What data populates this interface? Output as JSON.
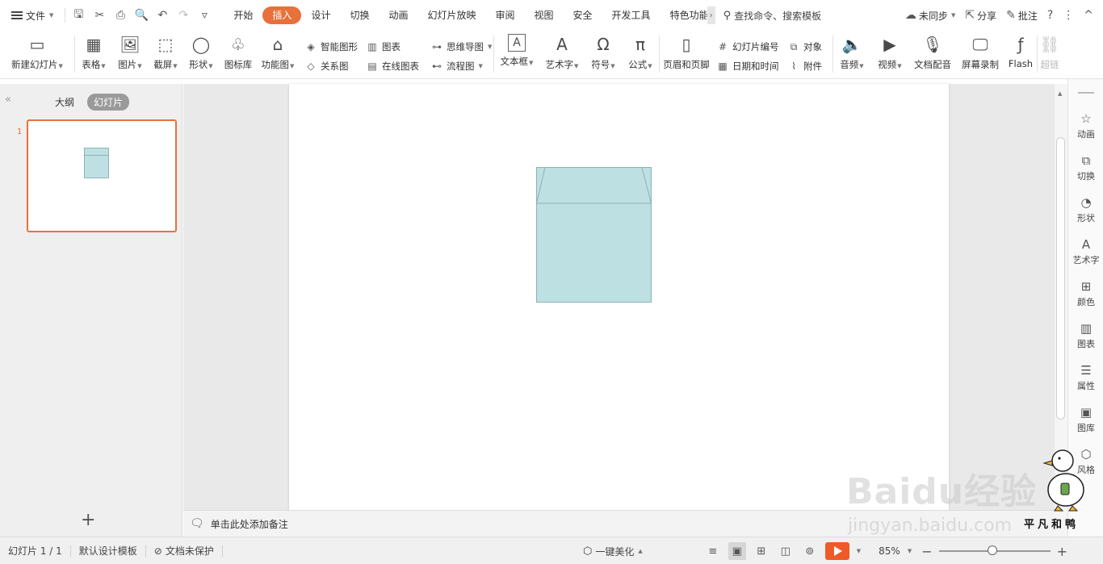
{
  "menubar": {
    "file_label": "文件",
    "tabs": [
      "开始",
      "插入",
      "设计",
      "切换",
      "动画",
      "幻灯片放映",
      "审阅",
      "视图",
      "安全",
      "开发工具",
      "特色功能"
    ],
    "active_tab": "插入",
    "search_label": "查找命令、搜索模板",
    "sync_label": "未同步",
    "share_label": "分享",
    "comment_label": "批注",
    "help": "?",
    "more": "⋮",
    "collapse": "^"
  },
  "ribbon": {
    "new_slide": "新建幻灯片",
    "table": "表格",
    "picture": "图片",
    "screenshot": "截屏",
    "shape": "形状",
    "icon_lib": "图标库",
    "func_chart": "功能图",
    "smart_shape": "智能图形",
    "chart": "图表",
    "relation": "关系图",
    "online_chart": "在线图表",
    "mindmap": "思维导图",
    "flowchart": "流程图",
    "textbox": "文本框",
    "wordart": "艺术字",
    "symbol": "符号",
    "formula": "公式",
    "header_footer": "页眉和页脚",
    "slide_number": "幻灯片编号",
    "object": "对象",
    "date_time": "日期和时间",
    "attachment": "附件",
    "audio": "音频",
    "video": "视频",
    "voiceover": "文档配音",
    "screen_record": "屏幕录制",
    "flash": "Flash",
    "hyperlink": "超链"
  },
  "left_panel": {
    "outline_tab": "大纲",
    "slides_tab": "幻灯片",
    "slide_number": "1",
    "add": "+"
  },
  "notes": {
    "placeholder": "单击此处添加备注"
  },
  "right_sidebar": {
    "items": [
      "动画",
      "切换",
      "形状",
      "艺术字",
      "颜色",
      "图表",
      "属性",
      "图库",
      "风格"
    ]
  },
  "status": {
    "slide_info": "幻灯片 1 / 1",
    "template": "默认设计模板",
    "protect": "文档未保护",
    "beautify": "一键美化",
    "zoom": "85%",
    "zoom_level": 0.48
  },
  "watermark": {
    "brand": "Baidu经验",
    "url": "jingyan.baidu.com",
    "signature": "平凡和鸭"
  },
  "colors": {
    "accent": "#e8703a",
    "shape_fill": "#bde0e2",
    "shape_stroke": "#8fb2b4"
  }
}
